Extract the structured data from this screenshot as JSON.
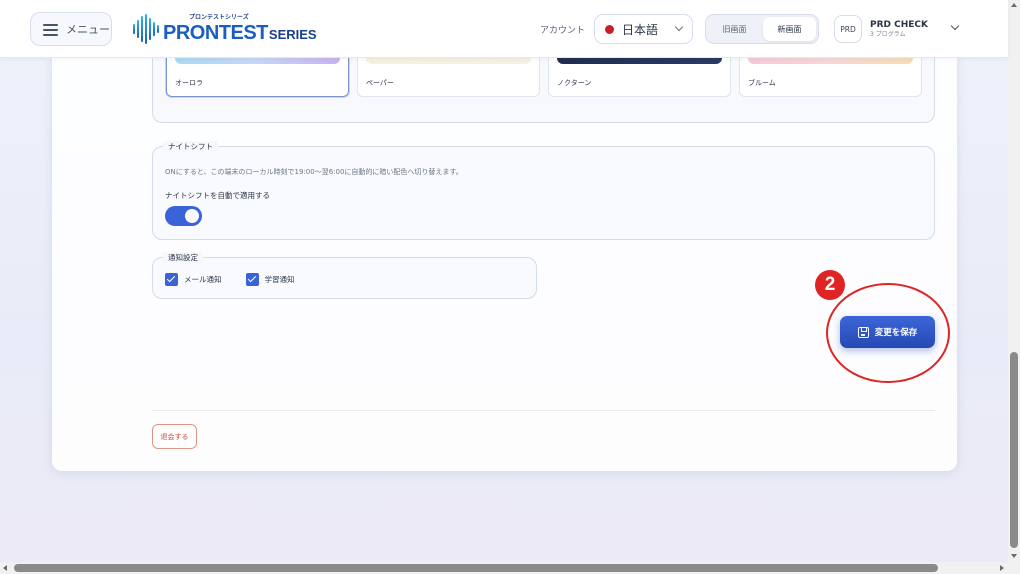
{
  "header": {
    "menu_label": "メニュー",
    "logo": {
      "sub": "プロンテストシリーズ",
      "main": "PRONTEST",
      "suffix": "SERIES"
    },
    "account_label": "アカウント",
    "language": {
      "selected": "日本語"
    },
    "view_toggle": {
      "old_label": "旧画面",
      "new_label": "新画面",
      "active": "new"
    },
    "account": {
      "avatar_text": "PRD",
      "name": "PRD CHECK",
      "subtitle": "3 プログラム"
    }
  },
  "themes": [
    {
      "name": "オーロラ",
      "selected": true
    },
    {
      "name": "ペーパー",
      "selected": false
    },
    {
      "name": "ノクターン",
      "selected": false
    },
    {
      "name": "ブルーム",
      "selected": false
    }
  ],
  "night_shift": {
    "legend": "ナイトシフト",
    "description": "ONにすると、この端末のローカル時刻で19:00〜翌6:00に自動的に暗い配色へ切り替えます。",
    "toggle_label": "ナイトシフトを自動で適用する",
    "enabled": true
  },
  "notifications": {
    "legend": "通知設定",
    "items": [
      {
        "label": "メール通知",
        "checked": true
      },
      {
        "label": "学習通知",
        "checked": true
      }
    ]
  },
  "save_button": {
    "label": "変更を保存"
  },
  "annotation": {
    "step": "2"
  },
  "withdraw_button": {
    "label": "退会する"
  },
  "colors": {
    "accent": "#3a63d8",
    "annotation": "#e02424",
    "danger": "#c44a3a"
  }
}
